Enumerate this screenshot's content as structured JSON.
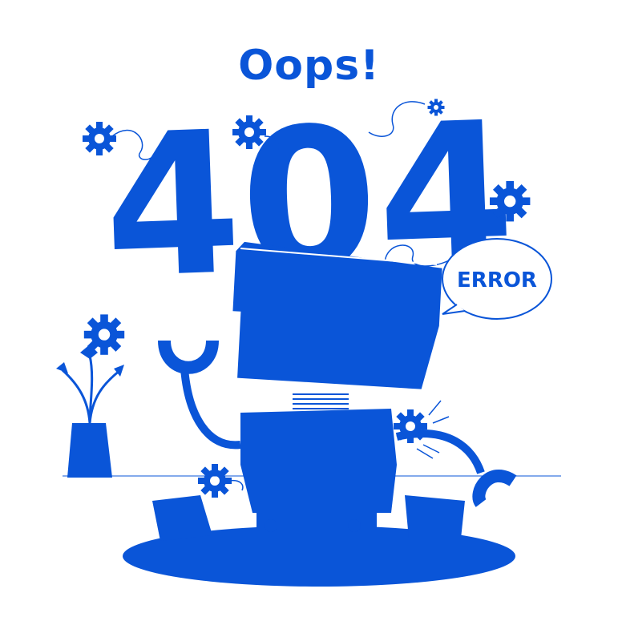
{
  "headline": "Oops!",
  "code": "404",
  "bubble": "ERROR",
  "colors": {
    "accent": "#0a55d8",
    "background": "#ffffff"
  },
  "illustration": {
    "subject": "broken-robot",
    "icons": [
      "gear-icon",
      "gear-icon",
      "gear-icon",
      "gear-icon",
      "gear-icon",
      "gear-icon",
      "plant-icon",
      "speech-bubble-icon"
    ]
  }
}
